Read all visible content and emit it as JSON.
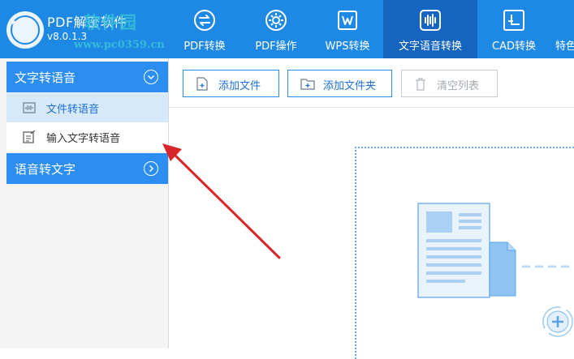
{
  "app": {
    "title": "PDF解密软件",
    "version": "v8.0.1.3",
    "watermark_text": "软件园",
    "watermark_url": "www.pc0359.cn"
  },
  "tabs": [
    {
      "label": "PDF转换",
      "icon": "convert-arrows-icon"
    },
    {
      "label": "PDF操作",
      "icon": "gear-icon"
    },
    {
      "label": "WPS转换",
      "icon": "wps-w-icon"
    },
    {
      "label": "文字语音转换",
      "icon": "audio-wave-icon",
      "active": true
    },
    {
      "label": "CAD转换",
      "icon": "cad-icon"
    },
    {
      "label": "特色",
      "icon": ""
    }
  ],
  "sidebar": {
    "section1": {
      "label": "文字转语音",
      "items": [
        {
          "label": "文件转语音",
          "icon": "audio-file-icon",
          "selected": true
        },
        {
          "label": "输入文字转语音",
          "icon": "edit-text-icon",
          "selected": false
        }
      ]
    },
    "section2": {
      "label": "语音转文字"
    }
  },
  "toolbar": {
    "add_file": "添加文件",
    "add_folder": "添加文件夹",
    "clear_list": "清空列表"
  },
  "colors": {
    "topbar": "#1e88e5",
    "active_tab": "#1565c0",
    "sidebar_header": "#2b8ef0",
    "selected_item": "#d5e9fb",
    "arrow": "#d9262a"
  }
}
